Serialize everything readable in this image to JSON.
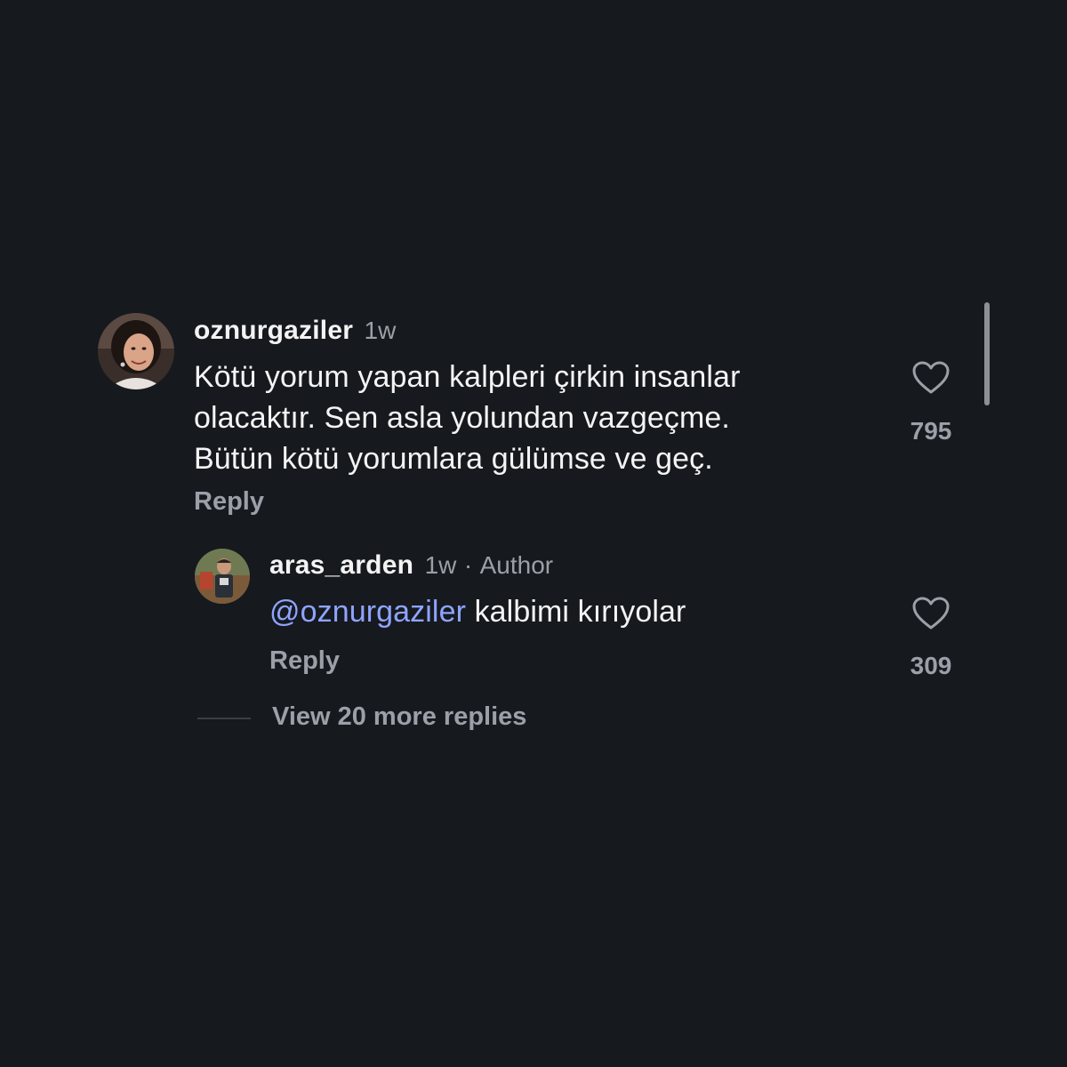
{
  "comment": {
    "username": "oznurgaziler",
    "time": "1w",
    "lines": [
      "Kötü yorum yapan kalpleri çirkin insanlar",
      "olacaktır. Sen asla yolundan vazgeçme.",
      "Bütün kötü yorumlara gülümse ve geç."
    ],
    "reply_label": "Reply",
    "like_count": "795"
  },
  "reply": {
    "username": "aras_arden",
    "time": "1w",
    "separator": "·",
    "author_badge": "Author",
    "mention": "@oznurgaziler",
    "text": " kalbimi kırıyolar",
    "reply_label": "Reply",
    "like_count": "309"
  },
  "view_more_label": "View 20 more replies",
  "icons": {
    "like": "heart-outline-icon"
  },
  "colors": {
    "background": "#16191e",
    "mention": "#8fa4ff",
    "secondary_text": "#9ba0a8"
  }
}
